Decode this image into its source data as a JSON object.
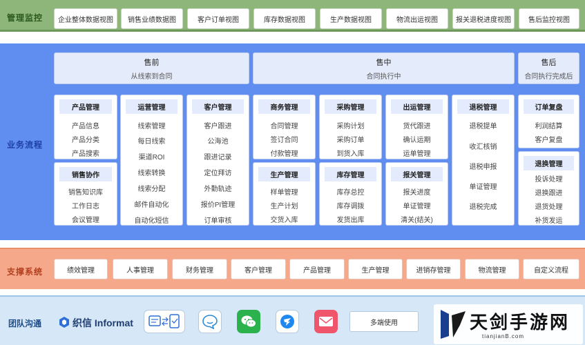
{
  "monitor": {
    "label": "管理监控",
    "items": [
      "企业整体数据视图",
      "销售业绩数据图",
      "客户订单视图",
      "库存数据视图",
      "生产数据视图",
      "物流出运视图",
      "报关退税进度视图",
      "售后监控视图"
    ]
  },
  "business": {
    "label": "业务流程",
    "phases": [
      {
        "title": "售前",
        "sub": "从线索到合同"
      },
      {
        "title": "售中",
        "sub": "合同执行中"
      },
      {
        "title": "售后",
        "sub": "合同执行完成后"
      }
    ],
    "modules": {
      "product": {
        "title": "产品管理",
        "items": [
          "产品信息",
          "产品分类",
          "产品搜索"
        ]
      },
      "sales": {
        "title": "销售协作",
        "items": [
          "销售知识库",
          "工作日志",
          "会议管理"
        ]
      },
      "ops": {
        "title": "运营管理",
        "items": [
          "线索管理",
          "每日线索",
          "渠道ROI",
          "线索转换",
          "线索分配",
          "邮件自动化",
          "自动化短信"
        ]
      },
      "customer": {
        "title": "客户管理",
        "items": [
          "客户跟进",
          "公海池",
          "跟进记录",
          "定位拜访",
          "外勤轨迹",
          "报价PI管理",
          "订单审核"
        ]
      },
      "commerce": {
        "title": "商务管理",
        "items": [
          "合同管理",
          "签订合同",
          "付款管理"
        ]
      },
      "production": {
        "title": "生产管理",
        "items": [
          "样单管理",
          "生产计划",
          "交货入库"
        ]
      },
      "purchase": {
        "title": "采购管理",
        "items": [
          "采购计划",
          "采购订单",
          "到货入库"
        ]
      },
      "inventory": {
        "title": "库存管理",
        "items": [
          "库存总控",
          "库存调拨",
          "发货出库"
        ]
      },
      "shipping": {
        "title": "出运管理",
        "items": [
          "货代跟进",
          "确认运期",
          "运单管理"
        ]
      },
      "customs": {
        "title": "报关管理",
        "items": [
          "报关进度",
          "单证管理",
          "清关(结关)"
        ]
      },
      "tax": {
        "title": "退税管理",
        "items": [
          "退税提单",
          "收汇核销",
          "退税申报",
          "单证管理",
          "退税完成"
        ]
      },
      "review": {
        "title": "订单复盘",
        "items": [
          "利润结算",
          "客户复盘"
        ]
      },
      "returns": {
        "title": "退换管理",
        "items": [
          "投诉处理",
          "退换跟进",
          "退货处理",
          "补货发运"
        ]
      }
    }
  },
  "support": {
    "label": "支撑系统",
    "items": [
      "绩效管理",
      "人事管理",
      "财务管理",
      "客户管理",
      "产品管理",
      "生产管理",
      "进销存管理",
      "物流管理",
      "自定义流程"
    ]
  },
  "team": {
    "label": "团队沟通",
    "brand": "织信 Informat",
    "apps": [
      "exchange-app-icon",
      "chat-bubble-app-icon",
      "wechat-app-icon",
      "dingtalk-app-icon",
      "mail-app-icon"
    ],
    "multi_label": "多端使用"
  },
  "watermark": {
    "cn": "天剑手游网",
    "en": "tianjianB.com"
  },
  "colors": {
    "monitor": "#8eb57a",
    "business": "#5f8ef0",
    "support": "#f5a88a",
    "team": "#d6e8f7"
  }
}
